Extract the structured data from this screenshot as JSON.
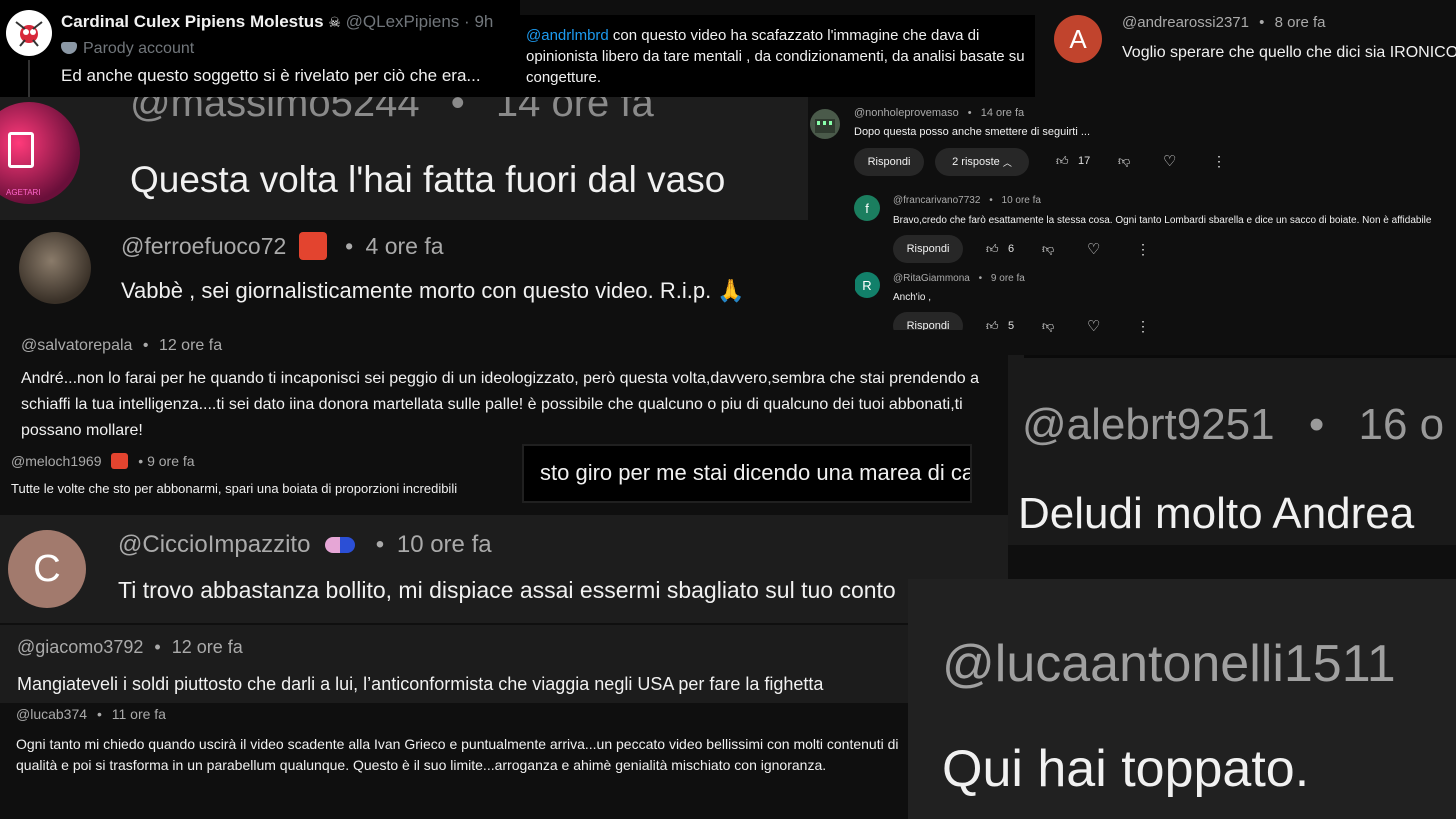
{
  "tweet": {
    "name": "Cardinal Culex Pipiens Molestus",
    "emoji": "☠",
    "handle": "@QLexPipiens",
    "time": "9h",
    "badge": "Parody account",
    "text": "Ed anche questo soggetto si è rivelato per ciò che era..."
  },
  "reply_andrl": {
    "mention": "@andrlmbrd",
    "text": " con questo video ha scafazzato l'immagine che dava di opinionista libero da tare mentali , da condizionamenti, da analisi basate su congetture."
  },
  "andrearossi": {
    "avatar_letter": "A",
    "handle": "@andrearossi2371",
    "time": "8 ore fa",
    "text": "Voglio sperare che quello che dici sia IRONICO."
  },
  "massimo": {
    "handle": "@massimo5244",
    "time": "14 ore fa",
    "text": "Questa volta l'hai fatta fuori dal vaso",
    "avatar_text": "AGETARI"
  },
  "thread": {
    "main": {
      "handle": "@nonholeprovemaso",
      "time": "14 ore fa",
      "text": "Dopo questa posso anche smettere di seguirti ...",
      "reply": "Rispondi",
      "replies": "2 risposte",
      "likes": "17"
    },
    "replies": [
      {
        "letter": "f",
        "color": "#1b7e5f",
        "handle": "@francarivano7732",
        "time": "10 ore fa",
        "text": "Bravo,credo che farò esattamente la stessa cosa. Ogni tanto Lombardi sbarella e dice un sacco di boiate. Non è affidabile",
        "reply": "Rispondi",
        "likes": "6"
      },
      {
        "letter": "R",
        "color": "#12806a",
        "handle": "@RitaGiammona",
        "time": "9 ore fa",
        "text": "Anch'io  ,",
        "reply": "Rispondi",
        "likes": "5"
      }
    ]
  },
  "ferro": {
    "handle": "@ferroefuoco72",
    "time": "4 ore fa",
    "text": "Vabbè , sei giornalisticamente morto con questo video. R.i.p. 🙏"
  },
  "salvatore": {
    "handle": "@salvatorepala",
    "time": "12 ore fa",
    "text": "André...non lo farai per he quando ti incaponisci sei peggio di un ideologizzato, però questa volta,davvero,sembra che stai prendendo a schiaffi la tua intelligenza....ti sei dato iina donora martellata sulle palle! è possibile che qualcuno o piu di qualcuno dei tuoi abbonati,ti possano mollare!"
  },
  "meloch": {
    "handle": "@meloch1969",
    "time": "9 ore fa",
    "text": "Tutte le volte che sto per abbonarmi, spari una boiata di proporzioni incredibili"
  },
  "giro": {
    "text": "sto giro per me stai dicendo una marea di cavolate,"
  },
  "alebrt": {
    "handle": "@alebrt9251",
    "time": "16 o",
    "text": "Deludi molto Andrea"
  },
  "ciccio": {
    "letter": "C",
    "handle": "@CiccioImpazzito",
    "time": "10 ore fa",
    "text": "Ti trovo abbastanza bollito, mi dispiace assai essermi sbagliato sul tuo conto"
  },
  "giacomo": {
    "handle": "@giacomo3792",
    "time": "12 ore fa",
    "text": "Mangiateveli i soldi piuttosto che darli a lui, l’anticonformista che viaggia negli USA per fare la fighetta"
  },
  "lucab": {
    "handle": "@lucab374",
    "time": "11 ore fa",
    "text": "Ogni tanto mi chiedo quando uscirà il video scadente alla Ivan Grieco e puntualmente arriva...un peccato video bellissimi con molti contenuti di qualità e poi si trasforma in un parabellum qualunque. Questo è il suo limite...arroganza e ahimè genialità mischiato con ignoranza."
  },
  "luca": {
    "handle": "@lucaantonelli1511",
    "text": "Qui hai toppato."
  },
  "sep": "•",
  "colors": {
    "link": "#1d9bf0",
    "youtube_red": "#e3442f",
    "panel_dark": "#212121"
  }
}
